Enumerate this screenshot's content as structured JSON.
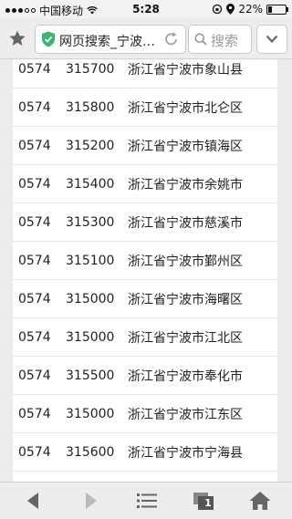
{
  "status_bar": {
    "carrier": "中国移动",
    "time": "5:28",
    "battery_percent": "22%",
    "battery_level": 0.22
  },
  "address_bar": {
    "url_title": "网页搜索_宁波…",
    "search_placeholder": "搜索"
  },
  "table": {
    "rows": [
      {
        "area_code": "0574",
        "postal_code": "315700",
        "region": "浙江省宁波市象山县"
      },
      {
        "area_code": "0574",
        "postal_code": "315800",
        "region": "浙江省宁波市北仑区"
      },
      {
        "area_code": "0574",
        "postal_code": "315200",
        "region": "浙江省宁波市镇海区"
      },
      {
        "area_code": "0574",
        "postal_code": "315400",
        "region": "浙江省宁波市余姚市"
      },
      {
        "area_code": "0574",
        "postal_code": "315300",
        "region": "浙江省宁波市慈溪市"
      },
      {
        "area_code": "0574",
        "postal_code": "315100",
        "region": "浙江省宁波市鄞州区"
      },
      {
        "area_code": "0574",
        "postal_code": "315000",
        "region": "浙江省宁波市海曙区"
      },
      {
        "area_code": "0574",
        "postal_code": "315000",
        "region": "浙江省宁波市江北区"
      },
      {
        "area_code": "0574",
        "postal_code": "315500",
        "region": "浙江省宁波市奉化市"
      },
      {
        "area_code": "0574",
        "postal_code": "315000",
        "region": "浙江省宁波市江东区"
      },
      {
        "area_code": "0574",
        "postal_code": "315600",
        "region": "浙江省宁波市宁海县"
      }
    ]
  },
  "bottom_bar": {
    "tab_count": "1"
  },
  "icons": {
    "bookmark": "star-icon",
    "secure": "shield-check-icon",
    "reload": "reload-icon",
    "search": "search-icon",
    "menu": "chevron-down-icon",
    "back": "back-arrow-icon",
    "forward": "forward-arrow-icon",
    "list": "list-icon",
    "tabs": "tabs-icon",
    "home": "home-icon"
  },
  "colors": {
    "accent": "#3a7bd5",
    "shield_green": "#3cb371",
    "icon_gray": "#666666"
  }
}
